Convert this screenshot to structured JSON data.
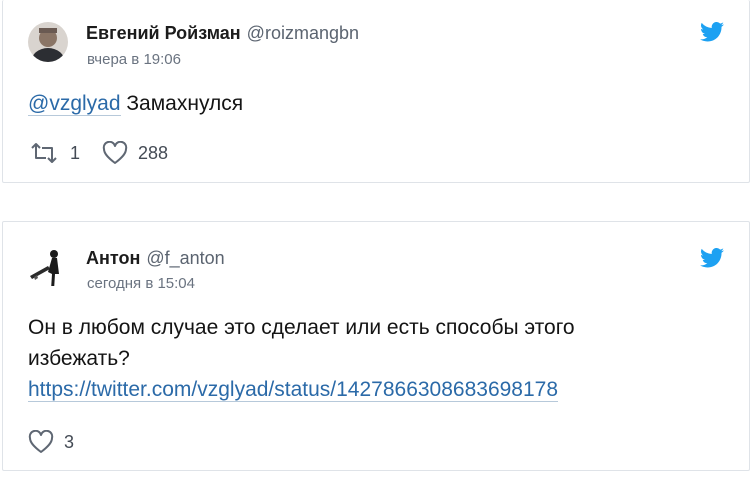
{
  "tweets": [
    {
      "author_name": "Евгений Ройзман",
      "author_handle": "@roizmangbn",
      "timestamp": "вчера в 19:06",
      "mention": "@vzglyad",
      "text": " Замахнулся",
      "retweet_count": "1",
      "like_count": "288",
      "brand_icon": "twitter-bird-icon",
      "brand_color": "#1da1f2"
    },
    {
      "author_name": "Антон",
      "author_handle": "@f_anton",
      "timestamp": "сегодня в 15:04",
      "text": "Он в любом случае это сделает или есть способы этого избежать?",
      "link": "https://twitter.com/vzglyad/status/1427866308683698178",
      "like_count": "3",
      "brand_icon": "twitter-bird-icon",
      "brand_color": "#1da1f2"
    }
  ]
}
